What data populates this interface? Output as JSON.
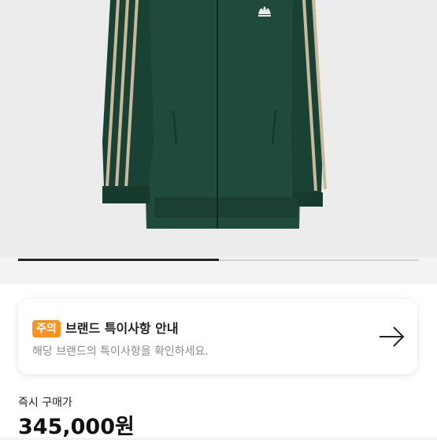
{
  "notice": {
    "badge": "주의",
    "title": "브랜드 특이사항 안내",
    "description": "해당 브랜드의 특이사항을 확인하세요."
  },
  "price": {
    "label": "즉시 구매가",
    "value": "345,000원"
  },
  "carousel": {
    "progress": 0.5
  },
  "colors": {
    "badge": "#f7931e",
    "jacket": "#1f4a3c",
    "stripe": "#c8b99a"
  },
  "icons": {
    "notice_arrow": "arrow-right-icon",
    "logo": "trefoil-logo"
  }
}
